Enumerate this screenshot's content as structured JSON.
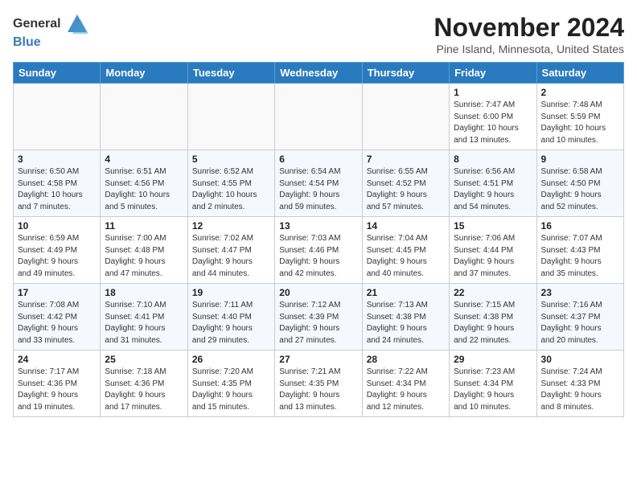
{
  "header": {
    "logo_general": "General",
    "logo_blue": "Blue",
    "month_title": "November 2024",
    "location": "Pine Island, Minnesota, United States"
  },
  "days_of_week": [
    "Sunday",
    "Monday",
    "Tuesday",
    "Wednesday",
    "Thursday",
    "Friday",
    "Saturday"
  ],
  "weeks": [
    [
      {
        "day": "",
        "info": ""
      },
      {
        "day": "",
        "info": ""
      },
      {
        "day": "",
        "info": ""
      },
      {
        "day": "",
        "info": ""
      },
      {
        "day": "",
        "info": ""
      },
      {
        "day": "1",
        "info": "Sunrise: 7:47 AM\nSunset: 6:00 PM\nDaylight: 10 hours\nand 13 minutes."
      },
      {
        "day": "2",
        "info": "Sunrise: 7:48 AM\nSunset: 5:59 PM\nDaylight: 10 hours\nand 10 minutes."
      }
    ],
    [
      {
        "day": "3",
        "info": "Sunrise: 6:50 AM\nSunset: 4:58 PM\nDaylight: 10 hours\nand 7 minutes."
      },
      {
        "day": "4",
        "info": "Sunrise: 6:51 AM\nSunset: 4:56 PM\nDaylight: 10 hours\nand 5 minutes."
      },
      {
        "day": "5",
        "info": "Sunrise: 6:52 AM\nSunset: 4:55 PM\nDaylight: 10 hours\nand 2 minutes."
      },
      {
        "day": "6",
        "info": "Sunrise: 6:54 AM\nSunset: 4:54 PM\nDaylight: 9 hours\nand 59 minutes."
      },
      {
        "day": "7",
        "info": "Sunrise: 6:55 AM\nSunset: 4:52 PM\nDaylight: 9 hours\nand 57 minutes."
      },
      {
        "day": "8",
        "info": "Sunrise: 6:56 AM\nSunset: 4:51 PM\nDaylight: 9 hours\nand 54 minutes."
      },
      {
        "day": "9",
        "info": "Sunrise: 6:58 AM\nSunset: 4:50 PM\nDaylight: 9 hours\nand 52 minutes."
      }
    ],
    [
      {
        "day": "10",
        "info": "Sunrise: 6:59 AM\nSunset: 4:49 PM\nDaylight: 9 hours\nand 49 minutes."
      },
      {
        "day": "11",
        "info": "Sunrise: 7:00 AM\nSunset: 4:48 PM\nDaylight: 9 hours\nand 47 minutes."
      },
      {
        "day": "12",
        "info": "Sunrise: 7:02 AM\nSunset: 4:47 PM\nDaylight: 9 hours\nand 44 minutes."
      },
      {
        "day": "13",
        "info": "Sunrise: 7:03 AM\nSunset: 4:46 PM\nDaylight: 9 hours\nand 42 minutes."
      },
      {
        "day": "14",
        "info": "Sunrise: 7:04 AM\nSunset: 4:45 PM\nDaylight: 9 hours\nand 40 minutes."
      },
      {
        "day": "15",
        "info": "Sunrise: 7:06 AM\nSunset: 4:44 PM\nDaylight: 9 hours\nand 37 minutes."
      },
      {
        "day": "16",
        "info": "Sunrise: 7:07 AM\nSunset: 4:43 PM\nDaylight: 9 hours\nand 35 minutes."
      }
    ],
    [
      {
        "day": "17",
        "info": "Sunrise: 7:08 AM\nSunset: 4:42 PM\nDaylight: 9 hours\nand 33 minutes."
      },
      {
        "day": "18",
        "info": "Sunrise: 7:10 AM\nSunset: 4:41 PM\nDaylight: 9 hours\nand 31 minutes."
      },
      {
        "day": "19",
        "info": "Sunrise: 7:11 AM\nSunset: 4:40 PM\nDaylight: 9 hours\nand 29 minutes."
      },
      {
        "day": "20",
        "info": "Sunrise: 7:12 AM\nSunset: 4:39 PM\nDaylight: 9 hours\nand 27 minutes."
      },
      {
        "day": "21",
        "info": "Sunrise: 7:13 AM\nSunset: 4:38 PM\nDaylight: 9 hours\nand 24 minutes."
      },
      {
        "day": "22",
        "info": "Sunrise: 7:15 AM\nSunset: 4:38 PM\nDaylight: 9 hours\nand 22 minutes."
      },
      {
        "day": "23",
        "info": "Sunrise: 7:16 AM\nSunset: 4:37 PM\nDaylight: 9 hours\nand 20 minutes."
      }
    ],
    [
      {
        "day": "24",
        "info": "Sunrise: 7:17 AM\nSunset: 4:36 PM\nDaylight: 9 hours\nand 19 minutes."
      },
      {
        "day": "25",
        "info": "Sunrise: 7:18 AM\nSunset: 4:36 PM\nDaylight: 9 hours\nand 17 minutes."
      },
      {
        "day": "26",
        "info": "Sunrise: 7:20 AM\nSunset: 4:35 PM\nDaylight: 9 hours\nand 15 minutes."
      },
      {
        "day": "27",
        "info": "Sunrise: 7:21 AM\nSunset: 4:35 PM\nDaylight: 9 hours\nand 13 minutes."
      },
      {
        "day": "28",
        "info": "Sunrise: 7:22 AM\nSunset: 4:34 PM\nDaylight: 9 hours\nand 12 minutes."
      },
      {
        "day": "29",
        "info": "Sunrise: 7:23 AM\nSunset: 4:34 PM\nDaylight: 9 hours\nand 10 minutes."
      },
      {
        "day": "30",
        "info": "Sunrise: 7:24 AM\nSunset: 4:33 PM\nDaylight: 9 hours\nand 8 minutes."
      }
    ]
  ]
}
